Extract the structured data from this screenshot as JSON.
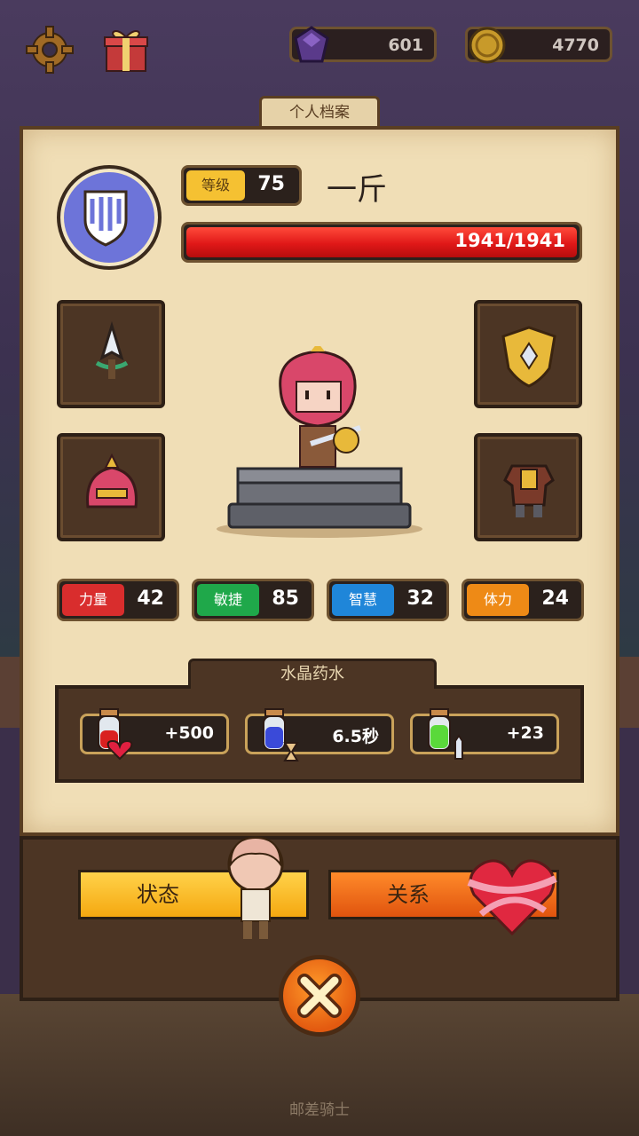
{
  "hud": {
    "gem_count": "601",
    "gold_count": "4770",
    "icons": [
      "gear-icon",
      "gift-icon",
      "purple-gem-icon",
      "gold-coin-icon"
    ]
  },
  "panel": {
    "tab_title": "个人档案",
    "level_label": "等级",
    "level_value": "75",
    "player_name": "一斤",
    "hp_text": "1941/1941",
    "hp_fraction": 1.0
  },
  "stats": [
    {
      "label": "力量",
      "value": "42",
      "color": "#d92d2d"
    },
    {
      "label": "敏捷",
      "value": "85",
      "color": "#1fa84a"
    },
    {
      "label": "智慧",
      "value": "32",
      "color": "#1f86d9"
    },
    {
      "label": "体力",
      "value": "24",
      "color": "#ee8a16"
    }
  ],
  "potions": {
    "title": "水晶药水",
    "items": [
      {
        "value": "+500",
        "icon": "red-potion-heart-icon"
      },
      {
        "value": "6.5秒",
        "icon": "blue-potion-hourglass-icon"
      },
      {
        "value": "+23",
        "icon": "green-potion-sword-icon"
      }
    ]
  },
  "buttons": {
    "status": "状态",
    "relations": "关系"
  },
  "footer": {
    "title": "邮差骑士"
  }
}
